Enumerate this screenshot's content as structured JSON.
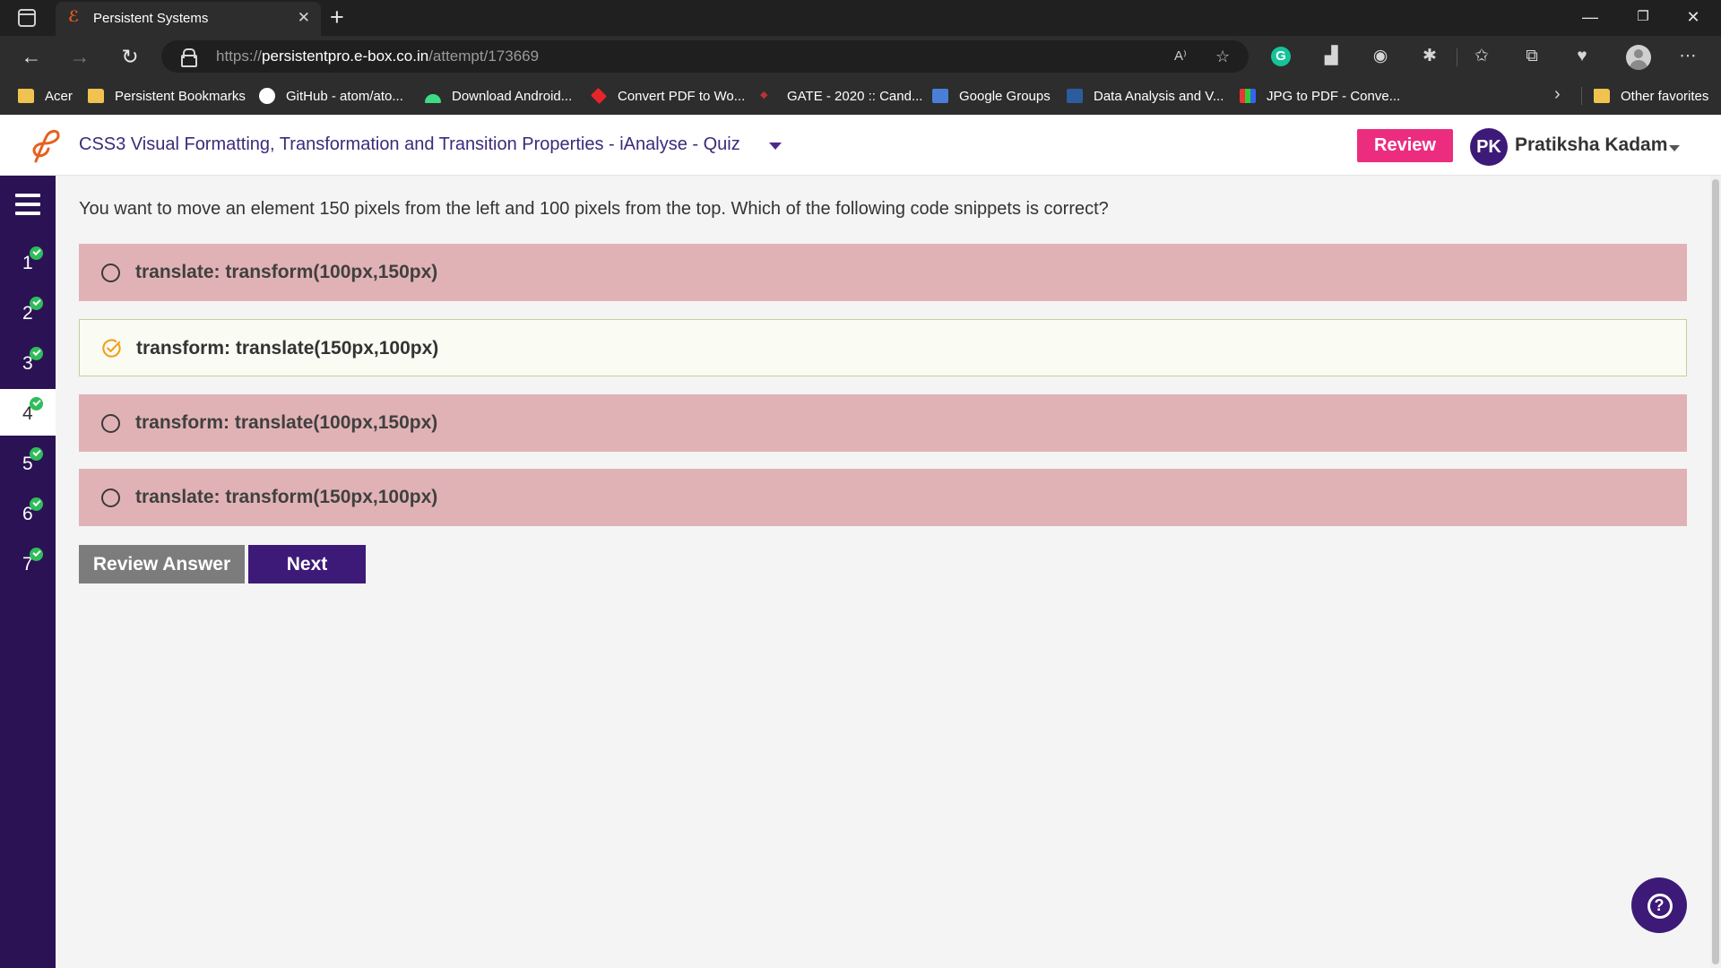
{
  "browser": {
    "tab_title": "Persistent Systems",
    "url_prefix": "https://",
    "url_host": "persistentpro.e-box.co.in",
    "url_path": "/attempt/173669",
    "bookmarks": [
      {
        "label": "Acer",
        "icon": "folder-icon"
      },
      {
        "label": "Persistent Bookmarks",
        "icon": "folder-icon"
      },
      {
        "label": "GitHub - atom/ato...",
        "icon": "github-icon"
      },
      {
        "label": "Download Android...",
        "icon": "android-icon"
      },
      {
        "label": "Convert PDF to Wo...",
        "icon": "pdf-icon"
      },
      {
        "label": "GATE - 2020 :: Cand...",
        "icon": "gate-icon"
      },
      {
        "label": "Google Groups",
        "icon": "groups-icon"
      },
      {
        "label": "Data Analysis and V...",
        "icon": "data-icon"
      },
      {
        "label": "JPG to PDF - Conve...",
        "icon": "jpg-icon"
      }
    ],
    "other_favorites": "Other favorites"
  },
  "header": {
    "title": "CSS3 Visual Formatting, Transformation and Transition Properties - iAnalyse - Quiz",
    "review_label": "Review",
    "avatar_initials": "PK",
    "user_name": "Pratiksha Kadam"
  },
  "sidebar": {
    "questions": [
      {
        "number": "1",
        "answered": true,
        "active": false
      },
      {
        "number": "2",
        "answered": true,
        "active": false
      },
      {
        "number": "3",
        "answered": true,
        "active": false
      },
      {
        "number": "4",
        "answered": true,
        "active": true
      },
      {
        "number": "5",
        "answered": true,
        "active": false
      },
      {
        "number": "6",
        "answered": true,
        "active": false
      },
      {
        "number": "7",
        "answered": true,
        "active": false
      }
    ]
  },
  "quiz": {
    "question": "You want to move an element 150 pixels from the left and 100 pixels from the top. Which of the following code snippets is correct?",
    "options": [
      {
        "label": "translate: transform(100px,150px)",
        "status": "incorrect"
      },
      {
        "label": "transform: translate(150px,100px)",
        "status": "correct"
      },
      {
        "label": "transform: translate(100px,150px)",
        "status": "incorrect"
      },
      {
        "label": "translate: transform(150px,100px)",
        "status": "incorrect"
      }
    ],
    "review_answer_label": "Review Answer",
    "next_label": "Next"
  },
  "colors": {
    "brand_purple": "#3d1a78",
    "review_pink": "#ec2d7f",
    "incorrect_bg": "#e1b2b5",
    "correct_bg": "#fafbf3",
    "check_green": "#2ebd59",
    "correct_icon_orange": "#f0a01e"
  }
}
